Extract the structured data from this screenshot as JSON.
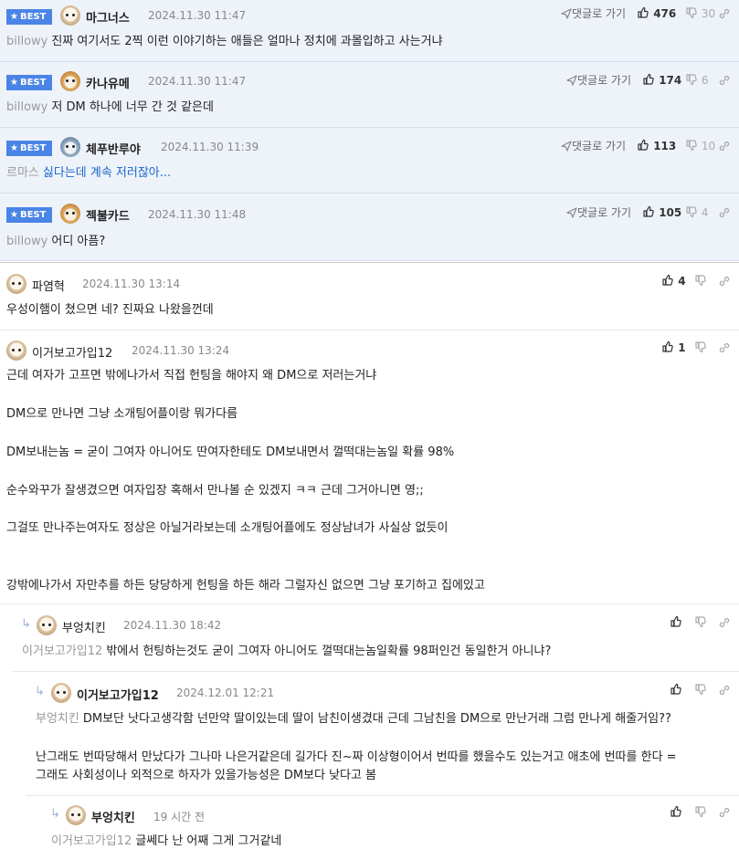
{
  "best_comments": [
    {
      "badge": "BEST",
      "nickname": "마그너스",
      "date": "2024.11.30 11:47",
      "mention": "billowy",
      "text": "진짜 여기서도 2찍 이런 이야기하는 애들은 얼마나 정치에 과몰입하고 사는거냐",
      "reply_link": "댓글로 가기",
      "up": "476",
      "down": "30"
    },
    {
      "badge": "BEST",
      "nickname": "카나유메",
      "date": "2024.11.30 11:47",
      "mention": "billowy",
      "text": "저 DM 하나에 너무 간 것 같은데",
      "reply_link": "댓글로 가기",
      "up": "174",
      "down": "6"
    },
    {
      "badge": "BEST",
      "nickname": "체푸반루야",
      "date": "2024.11.30 11:39",
      "mention": "르마스",
      "text": "싫다는데 계속 저러잖아...",
      "reply_link": "댓글로 가기",
      "up": "113",
      "down": "10"
    },
    {
      "badge": "BEST",
      "nickname": "젝불카드",
      "date": "2024.11.30 11:48",
      "mention": "billowy",
      "text": "어디 아픔?",
      "reply_link": "댓글로 가기",
      "up": "105",
      "down": "4"
    }
  ],
  "comments": [
    {
      "nickname": "파염혁",
      "date": "2024.11.30 13:14",
      "text": "우성이햄이 쳤으면 네? 진짜요 나왔을껀데",
      "up": "4"
    },
    {
      "nickname": "이거보고가입12",
      "date": "2024.11.30 13:24",
      "up": "1",
      "lines": [
        "근데 여자가 고프면 밖에나가서 직접 헌팅을 해야지 왜 DM으로 저러는거냐",
        "DM으로 만나면 그냥 소개팅어플이랑 뭐가다름",
        "DM보내는놈 = 굳이 그여자 아니어도 딴여자한테도 DM보내면서 껄떡대는놈일 확률 98%",
        "순수와꾸가 잘생겼으면 여자입장 혹해서 만나볼 순 있겠지 ㅋㅋ 근데 그거아니면 영;;",
        "그걸또 만나주는여자도 정상은 아닐거라보는데 소개팅어플에도 정상남녀가 사실상 없듯이",
        "강밖에나가서 자만추를 하든 당당하게 헌팅을 하든 해라 그럴자신 없으면 그냥 포기하고 집에있고"
      ]
    }
  ],
  "replies": [
    {
      "nickname": "부엉치킨",
      "date": "2024.11.30 18:42",
      "mention": "이거보고가입12",
      "text": "밖에서 헌팅하는것도 굳이 그여자 아니어도 껄떡대는놈일확률 98퍼인건 동일한거 아니냐?"
    },
    {
      "nickname": "이거보고가입12",
      "date": "2024.12.01 12:21",
      "mention": "부엉치킨",
      "text": "DM보단 낫다고생각함 넌만약 딸이있는데 딸이 남친이생겼대 근데 그남친을 DM으로 만난거래 그럼 만나게 해줄거임??",
      "line2": "난그래도 번따당해서 만났다가 그나마 나은거같은데 길가다 진~짜 이상형이어서 번따를 했을수도 있는거고 애초에 번따를 한다 =",
      "line3": "그래도 사회성이나 외적으로 하자가 있을가능성은 DM보다 낮다고 봄"
    },
    {
      "nickname": "부엉치킨",
      "date": "19 시간 전",
      "mention": "이거보고가입12",
      "text": "글쎄다 난 어째 그게 그거같네"
    }
  ]
}
